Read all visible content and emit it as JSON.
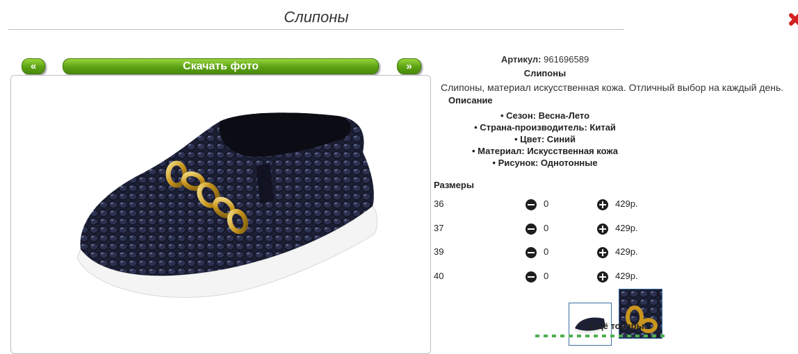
{
  "header": {
    "title": "Слипоны"
  },
  "nav": {
    "prev_label": "«",
    "download_label": "Скачать фото",
    "next_label": "»"
  },
  "product": {
    "article_label": "Артикул:",
    "article_value": "961696589",
    "name": "Слипоны",
    "description": "Слипоны, материал искусственная кожа. Отличный выбор на каждый день.",
    "description_heading": "Описание",
    "features": [
      "Сезон: Весна-Лето",
      "Страна-производитель: Китай",
      "Цвет: Синий",
      "Материал: Искусственная кожа",
      "Рисунок: Однотонные"
    ]
  },
  "sizes": {
    "heading": "Размеры",
    "rows": [
      {
        "size": "36",
        "qty": "0",
        "price": "429р."
      },
      {
        "size": "37",
        "qty": "0",
        "price": "429р."
      },
      {
        "size": "39",
        "qty": "0",
        "price": "429р."
      },
      {
        "size": "40",
        "qty": "0",
        "price": "429р."
      }
    ]
  },
  "more": {
    "label": "Ещё товары:"
  },
  "icons": {
    "close": "close-icon",
    "minus": "minus-circle-icon",
    "plus": "plus-circle-icon"
  },
  "colors": {
    "accent_green": "#5ba214",
    "close_red": "#d32020"
  }
}
